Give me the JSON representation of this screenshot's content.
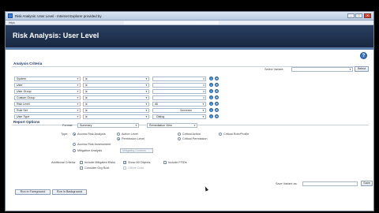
{
  "window": {
    "title": "Risk Analysis: User Level - Internet Explorer provided by",
    "address_label": "https",
    "address_url": "",
    "controls": [
      "–",
      "□",
      "✕"
    ]
  },
  "app": {
    "title": "Risk Analysis: User Level",
    "help_icon": "help-icon"
  },
  "analysis": {
    "title": "Analysis Criteria",
    "select_variant_label": "Select Variant:",
    "select_variant_value": "",
    "select_variant_button": "Select",
    "rows": [
      {
        "field": "System",
        "op": "is",
        "value": "",
        "value2": ""
      },
      {
        "field": "User",
        "op": "is",
        "value": "",
        "value2": ""
      },
      {
        "field": "User Group",
        "op": "is",
        "value": "",
        "value2": ""
      },
      {
        "field": "Custom Group",
        "op": "is",
        "value": "",
        "value2": ""
      },
      {
        "field": "Risk Level",
        "op": "is",
        "value": "All",
        "value2": ""
      },
      {
        "field": "Rule Set",
        "op": "is",
        "value": "",
        "value2": "Xxxxxxxx"
      },
      {
        "field": "User Type",
        "op": "is",
        "value": "",
        "value2": "Dialog"
      }
    ]
  },
  "report": {
    "title": "Report Options",
    "format_label": "Format:",
    "format_value": "Summary",
    "view_value": "Remediation View",
    "type_label": "Type:",
    "types": [
      {
        "label": "Access Risk Analysis",
        "checked": true
      },
      {
        "label": "Action Level",
        "checked": false
      },
      {
        "label": "Permission Level",
        "checked": true
      },
      {
        "label": "Critical Action",
        "checked": false
      },
      {
        "label": "Critical Permission",
        "checked": false
      },
      {
        "label": "Critical Role/Profile",
        "checked": false
      },
      {
        "label": "Access Risk Assessment",
        "checked": false
      },
      {
        "label": "Mitigation Analysis",
        "checked": false
      }
    ],
    "mitigation_field": "Mitigating Controls",
    "additional_label": "Additional Criteria:",
    "additional": [
      {
        "label": "Include Mitigated Risks",
        "checked": false
      },
      {
        "label": "Show All Objects",
        "checked": true
      },
      {
        "label": "Include FFIDs",
        "checked": false
      },
      {
        "label": "Consider Org Rule",
        "checked": false
      },
      {
        "label": "Offline Data",
        "checked": false
      }
    ],
    "save_variant_label": "Save Variant as:",
    "save_variant_value": "",
    "save_button": "Save"
  },
  "actions": {
    "run_foreground": "Run in Foreground",
    "run_background": "Run in Background"
  }
}
